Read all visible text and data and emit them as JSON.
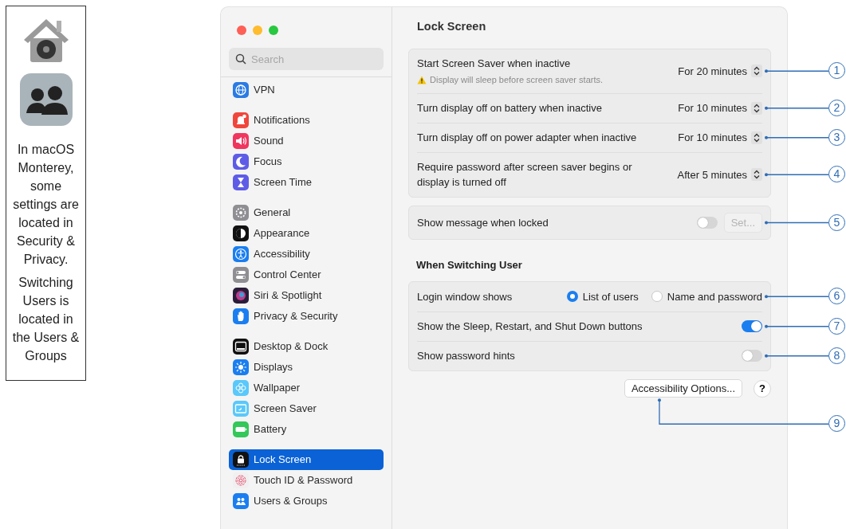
{
  "note": {
    "paragraphs": [
      "In macOS Monterey, some settings are located in Security & Privacy.",
      "Switching Users is located in the Users & Groups"
    ]
  },
  "sidebar": {
    "search": {
      "placeholder": "Search"
    },
    "groups": [
      {
        "items": [
          {
            "label": "VPN",
            "kind": "vpn",
            "selected": false
          }
        ]
      },
      {
        "items": [
          {
            "label": "Notifications",
            "kind": "notifications",
            "selected": false
          },
          {
            "label": "Sound",
            "kind": "sound",
            "selected": false
          },
          {
            "label": "Focus",
            "kind": "focus",
            "selected": false
          },
          {
            "label": "Screen Time",
            "kind": "screentime",
            "selected": false
          }
        ]
      },
      {
        "items": [
          {
            "label": "General",
            "kind": "general",
            "selected": false
          },
          {
            "label": "Appearance",
            "kind": "appearance",
            "selected": false
          },
          {
            "label": "Accessibility",
            "kind": "accessibility",
            "selected": false
          },
          {
            "label": "Control Center",
            "kind": "controlcenter",
            "selected": false
          },
          {
            "label": "Siri & Spotlight",
            "kind": "siri",
            "selected": false
          },
          {
            "label": "Privacy & Security",
            "kind": "privacy",
            "selected": false
          }
        ]
      },
      {
        "items": [
          {
            "label": "Desktop & Dock",
            "kind": "desktop",
            "selected": false
          },
          {
            "label": "Displays",
            "kind": "displays",
            "selected": false
          },
          {
            "label": "Wallpaper",
            "kind": "wallpaper",
            "selected": false
          },
          {
            "label": "Screen Saver",
            "kind": "screensaver",
            "selected": false
          },
          {
            "label": "Battery",
            "kind": "battery",
            "selected": false
          }
        ]
      },
      {
        "items": [
          {
            "label": "Lock Screen",
            "kind": "lockscreen",
            "selected": true
          },
          {
            "label": "Touch ID & Password",
            "kind": "touchid",
            "selected": false
          },
          {
            "label": "Users & Groups",
            "kind": "users",
            "selected": false
          }
        ]
      }
    ]
  },
  "main": {
    "title": "Lock Screen",
    "sections": [
      {
        "rows": [
          {
            "kind": "popup",
            "label": "Start Screen Saver when inactive",
            "warning": "Display will sleep before screen saver starts.",
            "value": "For 20 minutes",
            "callout": "1"
          },
          {
            "kind": "popup",
            "label": "Turn display off on battery when inactive",
            "value": "For 10 minutes",
            "callout": "2"
          },
          {
            "kind": "popup",
            "label": "Turn display off on power adapter when inactive",
            "value": "For 10 minutes",
            "callout": "3"
          },
          {
            "kind": "popup",
            "label": "Require password after screen saver begins or display is turned off",
            "value": "After 5 minutes",
            "callout": "4"
          }
        ]
      },
      {
        "rows": [
          {
            "kind": "toggle_button",
            "label": "Show message when locked",
            "on": false,
            "button": {
              "label": "Set...",
              "disabled": true
            },
            "callout": "5"
          }
        ]
      },
      {
        "heading": "When Switching User",
        "rows": [
          {
            "kind": "radio",
            "label": "Login window shows",
            "options": [
              {
                "label": "List of users",
                "selected": true
              },
              {
                "label": "Name and password",
                "selected": false
              }
            ],
            "callout": "6"
          },
          {
            "kind": "toggle",
            "label": "Show the Sleep, Restart, and Shut Down buttons",
            "on": true,
            "callout": "7"
          },
          {
            "kind": "toggle",
            "label": "Show password hints",
            "on": false,
            "callout": "8"
          }
        ]
      }
    ],
    "footer": {
      "button": "Accessibility Options...",
      "help": "?",
      "callout": "9"
    }
  }
}
